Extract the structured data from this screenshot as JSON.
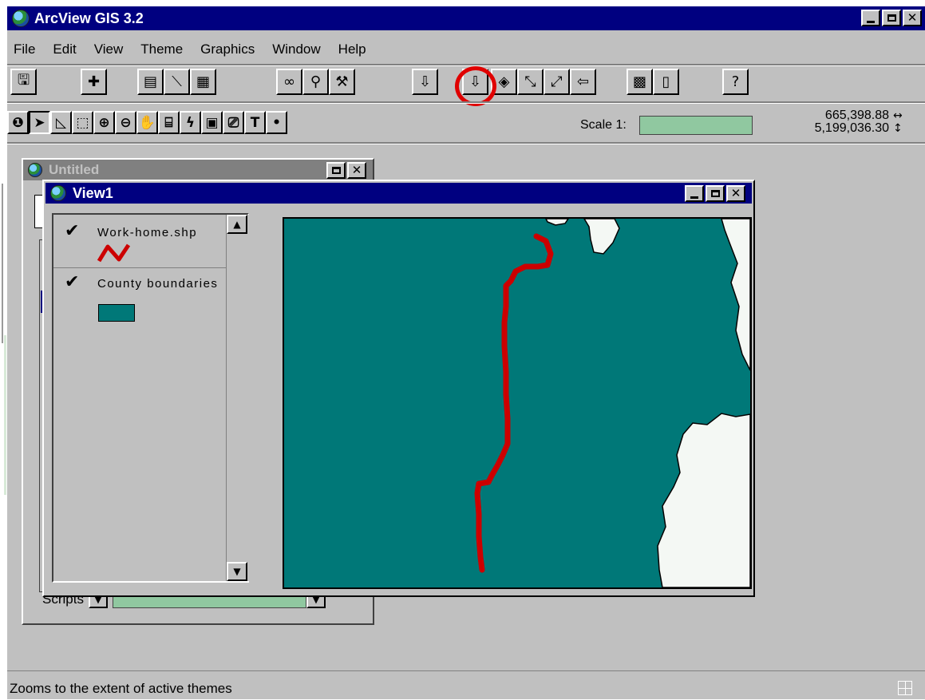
{
  "app": {
    "title": "ArcView GIS 3.2",
    "window_buttons": {
      "minimize": "_",
      "maximize": "□",
      "close": "✕"
    }
  },
  "menu": [
    "File",
    "Edit",
    "View",
    "Theme",
    "Graphics",
    "Window",
    "Help"
  ],
  "toolbar": {
    "buttons": [
      {
        "name": "save-project",
        "icon": "floppy-icon"
      },
      {
        "name": "add-theme",
        "icon": "plus-icon"
      },
      {
        "name": "theme-properties",
        "icon": "properties-icon"
      },
      {
        "name": "edit-legend",
        "icon": "legend-icon"
      },
      {
        "name": "open-theme-table",
        "icon": "table-icon"
      },
      {
        "name": "find",
        "icon": "binoculars-icon"
      },
      {
        "name": "locate-address",
        "icon": "locate-icon"
      },
      {
        "name": "query-builder",
        "icon": "hammer-icon"
      },
      {
        "name": "zoom-to-full-extent",
        "icon": "zoom-full-icon"
      },
      {
        "name": "zoom-to-active-themes",
        "icon": "zoom-active-icon"
      },
      {
        "name": "zoom-to-selected",
        "icon": "zoom-selected-icon"
      },
      {
        "name": "zoom-in-center",
        "icon": "zoom-in-center-icon"
      },
      {
        "name": "zoom-out-center",
        "icon": "zoom-out-center-icon"
      },
      {
        "name": "zoom-previous",
        "icon": "back-arrow-icon"
      },
      {
        "name": "select-by-theme",
        "icon": "select-theme-icon"
      },
      {
        "name": "clear-selected",
        "icon": "clear-icon"
      },
      {
        "name": "help",
        "icon": "help-arrow-icon"
      }
    ],
    "highlighted": "zoom-to-active-themes"
  },
  "tools": {
    "buttons": [
      {
        "name": "identify",
        "glyph": "❶"
      },
      {
        "name": "pointer",
        "glyph": "➤"
      },
      {
        "name": "vertex-edit",
        "glyph": "◺"
      },
      {
        "name": "select-feature",
        "glyph": "⬚"
      },
      {
        "name": "zoom-in",
        "glyph": "⊕"
      },
      {
        "name": "zoom-out",
        "glyph": "⊖"
      },
      {
        "name": "pan",
        "glyph": "✋"
      },
      {
        "name": "measure",
        "glyph": "⌸"
      },
      {
        "name": "hotlink",
        "glyph": "ϟ"
      },
      {
        "name": "area-of-interest",
        "glyph": "▣"
      },
      {
        "name": "label",
        "glyph": "⎚"
      },
      {
        "name": "text",
        "glyph": "T"
      },
      {
        "name": "draw-point",
        "glyph": "•"
      }
    ],
    "scale_label": "Scale 1:",
    "scale_value": "",
    "coord_x": "665,398.88",
    "coord_y": "5,199,036.30",
    "coord_x_arrow": "↔",
    "coord_y_arrow": "↕"
  },
  "project_window": {
    "title": "Untitled",
    "scripts_label": "Scripts",
    "scripts_value": ""
  },
  "view_window": {
    "title": "View1",
    "themes": [
      {
        "label": "Work-home.shp",
        "visible": true,
        "symbol": "line",
        "color": "#cc0000"
      },
      {
        "label": "County boundaries",
        "visible": true,
        "symbol": "polygon",
        "color": "#007878"
      }
    ],
    "map": {
      "background": "#007878",
      "land_white": "#f4f8f4",
      "route_color": "#cc0000"
    }
  },
  "status": {
    "text": "Zooms to the extent of active themes"
  }
}
